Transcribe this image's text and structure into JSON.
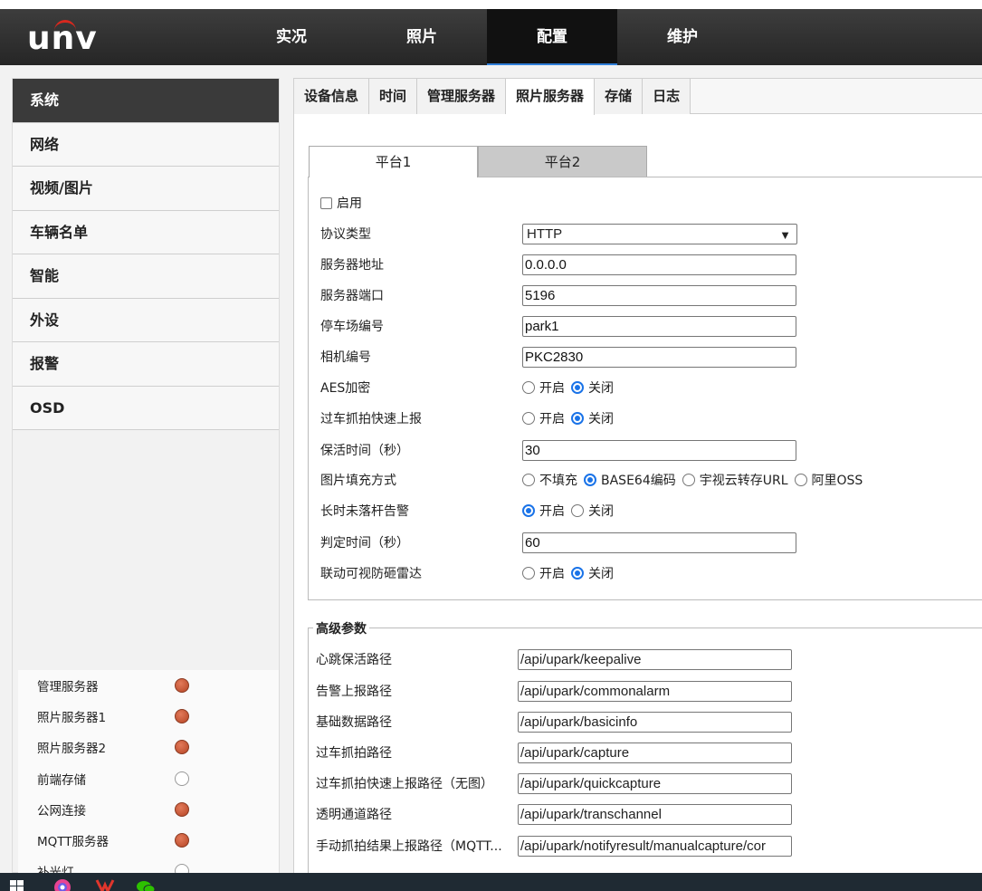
{
  "header": {
    "logo_text": "unv",
    "nav": [
      "实况",
      "照片",
      "配置",
      "维护"
    ],
    "active_nav_index": 2
  },
  "sidebar": {
    "items": [
      "系统",
      "网络",
      "视频/图片",
      "车辆名单",
      "智能",
      "外设",
      "报警",
      "OSD"
    ],
    "active_index": 0
  },
  "status_panel": {
    "items": [
      {
        "label": "管理服务器",
        "state": "on"
      },
      {
        "label": "照片服务器1",
        "state": "on"
      },
      {
        "label": "照片服务器2",
        "state": "on"
      },
      {
        "label": "前端存储",
        "state": "off"
      },
      {
        "label": "公网连接",
        "state": "on"
      },
      {
        "label": "MQTT服务器",
        "state": "on"
      },
      {
        "label": "补光灯",
        "state": "off"
      }
    ]
  },
  "tabs": {
    "items": [
      "设备信息",
      "时间",
      "管理服务器",
      "照片服务器",
      "存储",
      "日志"
    ],
    "active_index": 3
  },
  "platform_tabs": [
    "平台1",
    "平台2"
  ],
  "form": {
    "enable_label": "启用",
    "protocol_label": "协议类型",
    "protocol_value": "HTTP",
    "server_addr_label": "服务器地址",
    "server_addr_value": "0.0.0.0",
    "server_port_label": "服务器端口",
    "server_port_value": "5196",
    "park_no_label": "停车场编号",
    "park_no_value": "park1",
    "camera_no_label": "相机编号",
    "camera_no_value": "PKC2830",
    "aes_label": "AES加密",
    "quick_report_label": "过车抓拍快速上报",
    "keepalive_label": "保活时间（秒）",
    "keepalive_value": "30",
    "fill_mode_label": "图片填充方式",
    "fill_options": [
      "不填充",
      "BASE64编码",
      "宇视云转存URL",
      "阿里OSS"
    ],
    "long_alarm_label": "长时未落杆告警",
    "judge_time_label": "判定时间（秒）",
    "judge_time_value": "60",
    "radar_label": "联动可视防砸雷达",
    "on_label": "开启",
    "off_label": "关闭"
  },
  "advanced": {
    "title": "高级参数",
    "rows": [
      {
        "label": "心跳保活路径",
        "value": "/api/upark/keepalive"
      },
      {
        "label": "告警上报路径",
        "value": "/api/upark/commonalarm"
      },
      {
        "label": "基础数据路径",
        "value": "/api/upark/basicinfo"
      },
      {
        "label": "过车抓拍路径",
        "value": "/api/upark/capture"
      },
      {
        "label": "过车抓拍快速上报路径（无图）",
        "value": "/api/upark/quickcapture"
      },
      {
        "label": "透明通道路径",
        "value": "/api/upark/transchannel"
      },
      {
        "label": "手动抓拍结果上报路径（MQTT...",
        "value": "/api/upark/notifyresult/manualcapture/cor"
      }
    ]
  }
}
